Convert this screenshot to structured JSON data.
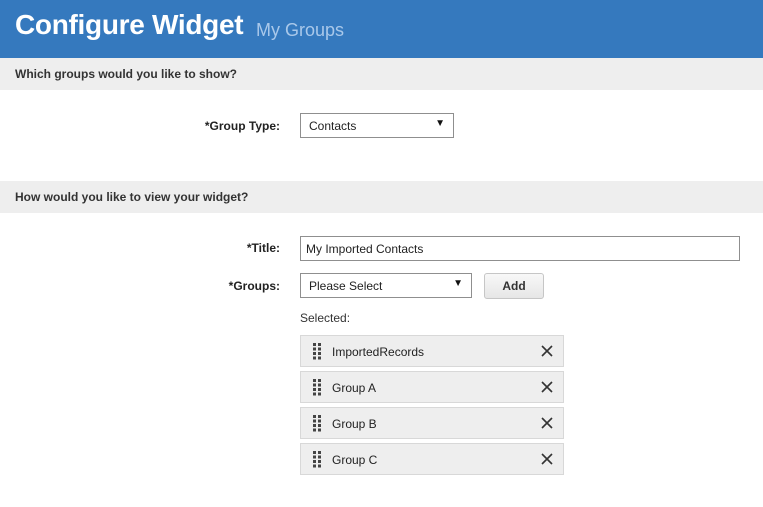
{
  "header": {
    "title": "Configure Widget",
    "subtitle": "My Groups"
  },
  "section1": {
    "heading": "Which groups would you like to show?",
    "group_type": {
      "label": "*Group Type:",
      "value": "Contacts"
    }
  },
  "section2": {
    "heading": "How would you like to view your widget?",
    "title_field": {
      "label": "*Title:",
      "value": "My Imported Contacts"
    },
    "groups_field": {
      "label": "*Groups:",
      "value": "Please Select",
      "add_label": "Add"
    },
    "selected_label": "Selected:",
    "selected_items": [
      {
        "label": "ImportedRecords"
      },
      {
        "label": "Group A"
      },
      {
        "label": "Group B"
      },
      {
        "label": "Group C"
      }
    ]
  },
  "colors": {
    "header_bg": "#3579be",
    "subtitle": "#a9c8ea",
    "section_bg": "#eeeeee"
  },
  "icons": {
    "dropdown": "dropdown-arrow-icon",
    "drag": "drag-handle-icon",
    "remove": "close-icon"
  }
}
